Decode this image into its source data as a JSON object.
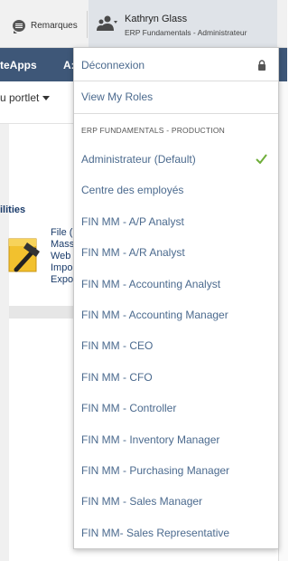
{
  "topbar": {
    "remarques_label": "Remarques",
    "user_name": "Kathryn Glass",
    "user_role": "ERP Fundamentals - Administrateur"
  },
  "background": {
    "nav_item_1": "teApps",
    "nav_item_2": "A:",
    "portlet_label": "u portlet",
    "section_title": "ilities",
    "tool_lines": [
      "File (",
      "Mass",
      "Web",
      "Impo",
      "Expo"
    ]
  },
  "menu": {
    "logout_label": "Déconnexion",
    "view_roles_label": "View My Roles",
    "section_header": "ERP FUNDAMENTALS - PRODUCTION",
    "roles": [
      "Administrateur (Default)",
      "Centre des employés",
      "FIN MM - A/P Analyst",
      "FIN MM - A/R Analyst",
      "FIN MM - Accounting Analyst",
      "FIN MM - Accounting Manager",
      "FIN MM - CEO",
      "FIN MM - CFO",
      "FIN MM - Controller",
      "FIN MM - Inventory Manager",
      "FIN MM - Purchasing Manager",
      "FIN MM - Sales Manager",
      "FIN MM- Sales Representative"
    ],
    "active_role_index": 0
  },
  "colors": {
    "menu_text": "#4b6a8e",
    "check": "#6fae3a",
    "nav_bg": "#3e5778",
    "user_area_bg": "#dfe3e8"
  },
  "icons": [
    "chat-bubble-icon",
    "users-icon",
    "lock-icon",
    "checkmark-icon",
    "tools-icon",
    "caret-down-icon"
  ]
}
